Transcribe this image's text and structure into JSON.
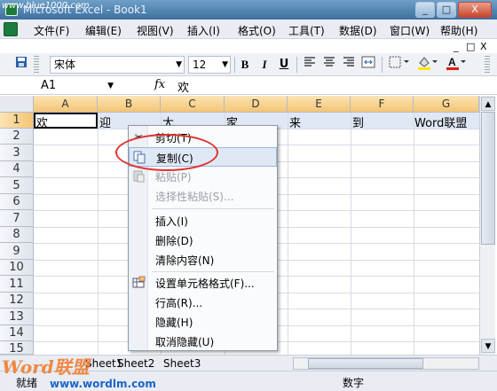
{
  "window": {
    "title": "Microsoft Excel - Book1",
    "watermark": "www.blue1000.com",
    "controls": [
      "_",
      "□",
      "X"
    ]
  },
  "menubar": {
    "items": [
      "文件(F)",
      "编辑(E)",
      "视图(V)",
      "插入(I)",
      "格式(O)",
      "工具(T)",
      "数据(D)",
      "窗口(W)",
      "帮助(H)"
    ],
    "right_controls": [
      "_",
      "□",
      "X"
    ]
  },
  "toolbar": {
    "font_name": "宋体",
    "font_size": "12",
    "bold": "B",
    "italic": "I",
    "underline": "U",
    "fill_color": "#ffe800",
    "font_color": "#e31b1b"
  },
  "formula": {
    "name_box": "A1",
    "fx": "fx",
    "content": "欢"
  },
  "grid": {
    "columns": [
      "A",
      "B",
      "C",
      "D",
      "E",
      "F",
      "G"
    ],
    "rows": [
      "1",
      "2",
      "3",
      "4",
      "5",
      "6",
      "7",
      "8",
      "9",
      "10",
      "11",
      "12",
      "13",
      "14",
      "15"
    ],
    "row1": [
      "欢",
      "迎",
      "大",
      "家",
      "来",
      "到",
      "Word联盟"
    ]
  },
  "context_menu": {
    "items": [
      {
        "label": "剪切(T)",
        "icon": "scissors-icon",
        "disabled": false
      },
      {
        "label": "复制(C)",
        "icon": "copy-icon",
        "disabled": false,
        "highlighted": true
      },
      {
        "label": "粘贴(P)",
        "icon": "paste-icon",
        "disabled": true
      },
      {
        "label": "选择性粘贴(S)...",
        "icon": "",
        "disabled": true
      },
      {
        "label": "插入(I)",
        "icon": "",
        "disabled": false
      },
      {
        "label": "删除(D)",
        "icon": "",
        "disabled": false
      },
      {
        "label": "清除内容(N)",
        "icon": "",
        "disabled": false
      },
      {
        "label": "设置单元格格式(F)...",
        "icon": "format-cells-icon",
        "disabled": false
      },
      {
        "label": "行高(R)...",
        "icon": "",
        "disabled": false
      },
      {
        "label": "隐藏(H)",
        "icon": "",
        "disabled": false
      },
      {
        "label": "取消隐藏(U)",
        "icon": "",
        "disabled": false
      }
    ]
  },
  "sheets": {
    "tabs": [
      "Sheet1",
      "Sheet2",
      "Sheet3"
    ]
  },
  "status": {
    "left": "就绪",
    "right": "数字"
  },
  "site_watermark": {
    "logo": "Word联盟",
    "url": "www.wordlm.com"
  }
}
